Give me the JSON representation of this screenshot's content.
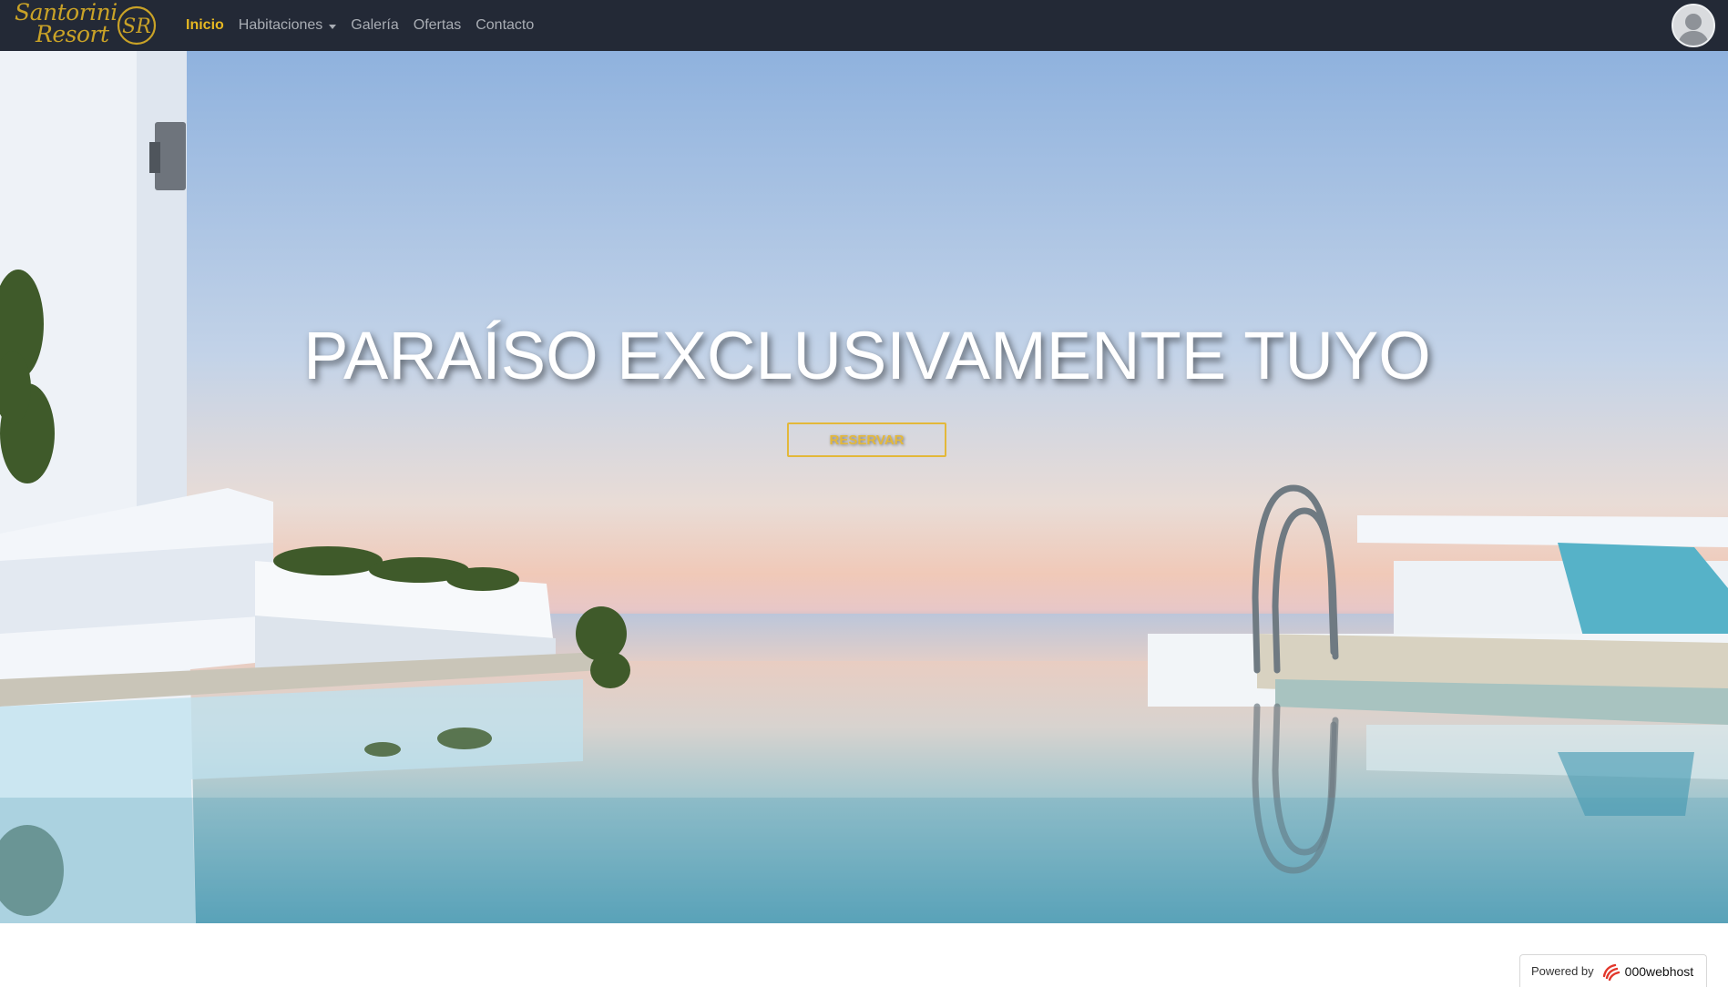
{
  "navbar": {
    "brand": {
      "line1": "Santorini",
      "line2": "Resort",
      "monogram": "SR"
    },
    "items": [
      {
        "label": "Inicio",
        "active": true
      },
      {
        "label": "Habitaciones",
        "dropdown": true
      },
      {
        "label": "Galería"
      },
      {
        "label": "Ofertas"
      },
      {
        "label": "Contacto"
      }
    ],
    "avatar_icon": "user-avatar-icon"
  },
  "hero": {
    "title": "PARAÍSO EXCLUSIVAMENTE TUYO",
    "button_label": "RESERVAR"
  },
  "footer_badge": {
    "label": "Powered by",
    "brand": "000webhost",
    "icon": "000webhost-logo-icon"
  },
  "colors": {
    "navbar_bg": "#232936",
    "accent_gold": "#e7b822",
    "nav_text": "#a9adb4",
    "button_border": "#e3b83a"
  }
}
